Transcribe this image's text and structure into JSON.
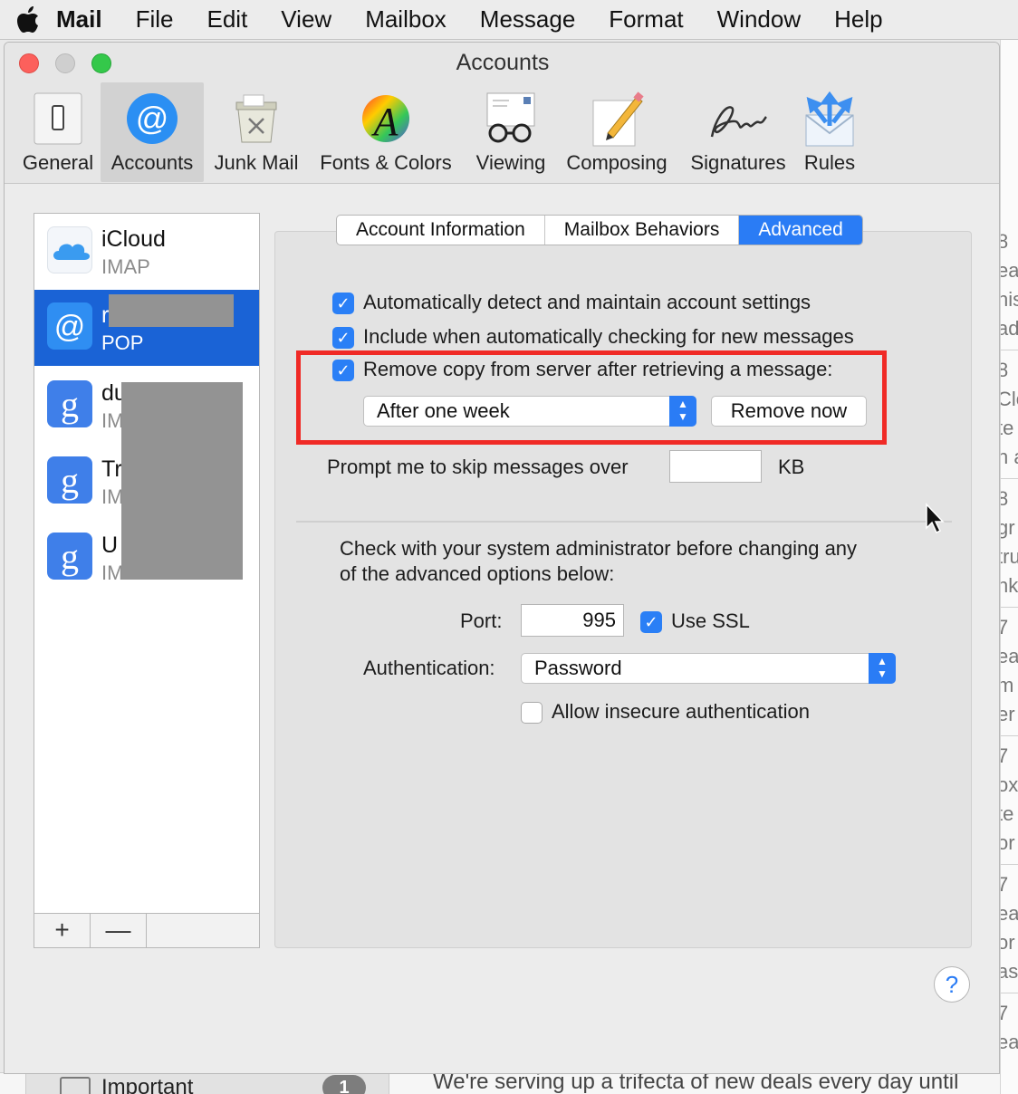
{
  "menubar": {
    "items": [
      "Mail",
      "File",
      "Edit",
      "View",
      "Mailbox",
      "Message",
      "Format",
      "Window",
      "Help"
    ]
  },
  "window": {
    "title": "Accounts",
    "toolbar": [
      {
        "label": "General",
        "icon": "general-icon"
      },
      {
        "label": "Accounts",
        "icon": "at-sign-icon",
        "active": true
      },
      {
        "label": "Junk Mail",
        "icon": "junk-mail-icon"
      },
      {
        "label": "Fonts & Colors",
        "icon": "fonts-colors-icon"
      },
      {
        "label": "Viewing",
        "icon": "viewing-icon"
      },
      {
        "label": "Composing",
        "icon": "composing-icon"
      },
      {
        "label": "Signatures",
        "icon": "signatures-icon"
      },
      {
        "label": "Rules",
        "icon": "rules-icon"
      }
    ]
  },
  "accounts": [
    {
      "name": "iCloud",
      "type": "IMAP",
      "icon": "icloud-icon"
    },
    {
      "name": "r",
      "type": "POP",
      "icon": "at-sign-icon",
      "selected": true
    },
    {
      "name": "du",
      "type": "IM",
      "icon": "google-icon"
    },
    {
      "name": "Tr",
      "type": "IM",
      "icon": "google-icon"
    },
    {
      "name": "U",
      "type": "IM",
      "icon": "google-icon"
    }
  ],
  "sidebar_footer": {
    "add": "+",
    "remove": "—"
  },
  "tabs": [
    "Account Information",
    "Mailbox Behaviors",
    "Advanced"
  ],
  "advanced": {
    "auto_detect": "Automatically detect and maintain account settings",
    "include_check": "Include when automatically checking for new messages",
    "remove_copy": "Remove copy from server after retrieving a message:",
    "remove_when": "After one week",
    "remove_now": "Remove now",
    "prompt_skip": "Prompt me to skip messages over",
    "prompt_value": "",
    "kb": "KB",
    "admin_note_1": "Check with your system administrator before changing any",
    "admin_note_2": "of the advanced options below:",
    "port_label": "Port:",
    "port_value": "995",
    "use_ssl": "Use SSL",
    "auth_label": "Authentication:",
    "auth_value": "Password",
    "allow_insecure": "Allow insecure authentication",
    "help": "?"
  },
  "background": {
    "mailbox": "Important",
    "badge": "1",
    "teaser": "We're serving up a trifecta of new deals every day until",
    "right_fragments": [
      "8",
      "ea",
      "his",
      "ad",
      "8",
      "Clo",
      "te",
      "n a",
      "8",
      "gr",
      "tru",
      "nk",
      "7",
      "ea",
      "m",
      "er",
      "7",
      "ox",
      "te",
      "or",
      "7",
      "ea",
      "or",
      "as",
      "7",
      "ea"
    ]
  },
  "colors": {
    "accent": "#2a7cf5",
    "selection": "#1a63d6",
    "highlight_box": "#f02a26",
    "close": "#fc605c",
    "minimize": "#c8c8c8",
    "zoom": "#34c84a"
  }
}
